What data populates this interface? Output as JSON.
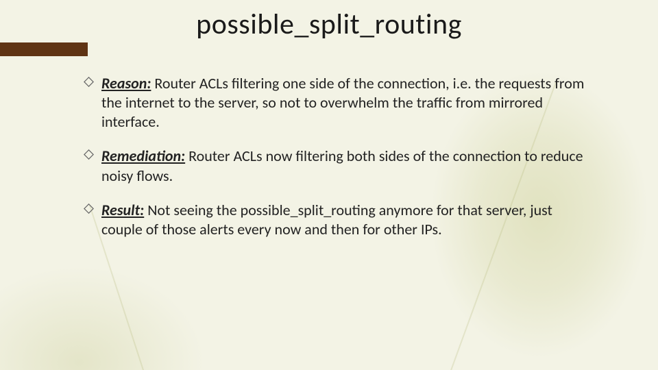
{
  "title": "possible_split_routing",
  "bullets": [
    {
      "label": "Reason:",
      "text": " Router ACLs filtering one side of the connection, i.e. the requests from the internet to the server, so not to overwhelm the traffic from mirrored interface."
    },
    {
      "label": "Remediation:",
      "text": " Router ACLs now filtering both sides of the connection to reduce noisy flows."
    },
    {
      "label": "Result:",
      "text": " Not seeing the possible_split_routing anymore for that server, just couple of those alerts every now and then for other IPs."
    }
  ],
  "accent_color": "#5f3414"
}
